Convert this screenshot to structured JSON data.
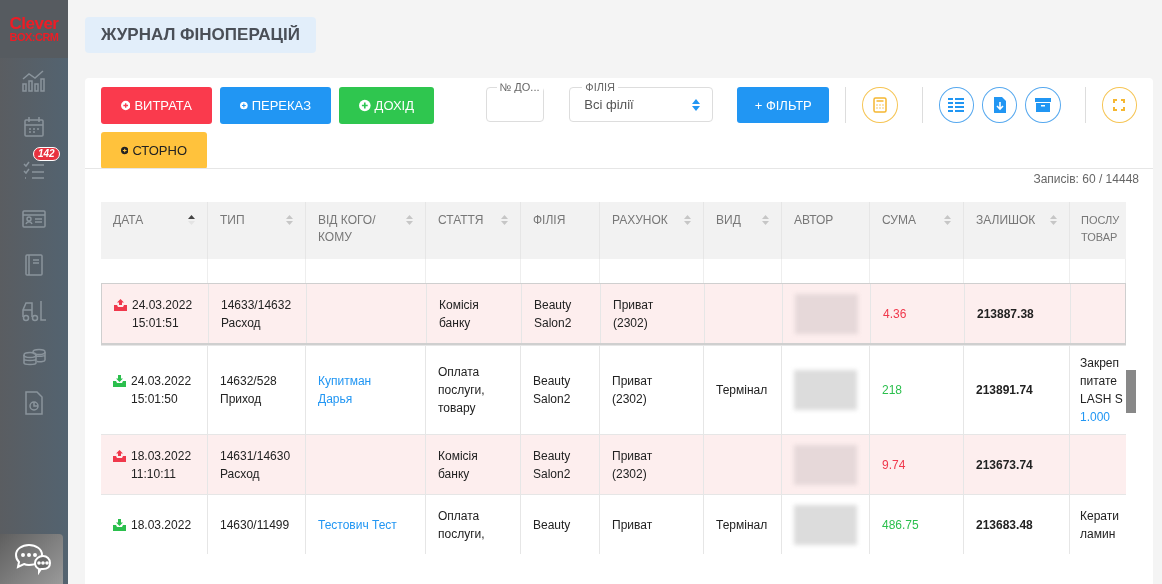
{
  "sidebar": {
    "logo_top": "Clever",
    "logo_bottom": "BOX:CRM",
    "tasks_badge": "142"
  },
  "page_title": "ЖУРНАЛ ФІНОПЕРАЦІЙ",
  "actions": [
    {
      "label": "ВИТРАТА",
      "kind": "danger"
    },
    {
      "label": "ПЕРЕКАЗ",
      "kind": "primary"
    },
    {
      "label": "ДОХІД",
      "kind": "success"
    },
    {
      "label": "СТОРНО",
      "kind": "warning"
    }
  ],
  "doc_field": {
    "label": "№ ДО..."
  },
  "branch_select": {
    "label": "ФІЛІЯ",
    "value": "Всі філії"
  },
  "filter_button": "+ ФІЛЬТР",
  "records": "Записів: 60 / 14448",
  "table": {
    "columns": [
      {
        "label": "ДАТА",
        "sortable": true,
        "sorted": true
      },
      {
        "label": "ТИП",
        "sortable": true,
        "sorted": false
      },
      {
        "label": "ВІД КОГО/КОМУ",
        "sortable": true,
        "sorted": false
      },
      {
        "label": "СТАТТЯ",
        "sortable": true,
        "sorted": false
      },
      {
        "label": "ФІЛІЯ",
        "sortable": false
      },
      {
        "label": "РАХУНОК",
        "sortable": true,
        "sorted": false
      },
      {
        "label": "ВИД",
        "sortable": true,
        "sorted": false
      },
      {
        "label": "АВТОР",
        "sortable": false
      },
      {
        "label": "СУМА",
        "sortable": true,
        "sorted": false
      },
      {
        "label": "ЗАЛИШОК",
        "sortable": true,
        "sorted": false
      },
      {
        "label": "ПОСЛУ ТОВАР",
        "sortable": false
      }
    ],
    "rows": [
      {
        "kind": "expense",
        "date": "24.03.2022",
        "time": "15:01:51",
        "number": "14633/14632",
        "type": "Расход",
        "article": [
          "Комісія",
          "банку"
        ],
        "branch": [
          "Beauty",
          "Salon2"
        ],
        "account": [
          "Приват",
          "(2302)"
        ],
        "sum": "4.36",
        "balance": "213887.38",
        "selected": true
      },
      {
        "kind": "income",
        "date": "24.03.2022",
        "time": "15:01:50",
        "number": "14632/528",
        "type": "Приход",
        "counterparty": [
          "Купитман",
          "Дарья"
        ],
        "article": [
          "Оплата",
          "послуги,",
          "товару"
        ],
        "branch": [
          "Beauty",
          "Salon2"
        ],
        "account": [
          "Приват",
          "(2302)"
        ],
        "method": "Термінал",
        "sum": "218",
        "balance": "213891.74",
        "services": [
          "Закреп",
          "питате",
          "LASH S"
        ],
        "quantity": "1.000",
        "selected": false
      },
      {
        "kind": "expense",
        "date": "18.03.2022",
        "time": "11:10:11",
        "number": "14631/14630",
        "type": "Расход",
        "article": [
          "Комісія",
          "банку"
        ],
        "branch": [
          "Beauty",
          "Salon2"
        ],
        "account": [
          "Приват",
          "(2302)"
        ],
        "sum": "9.74",
        "balance": "213673.74",
        "selected": false
      },
      {
        "kind": "income",
        "date": "18.03.2022",
        "number": "14630/11499",
        "counterparty": [
          "Тестович Тест"
        ],
        "article": [
          "Оплата",
          "послуги,"
        ],
        "branch": [
          "Beauty"
        ],
        "account": [
          "Приват"
        ],
        "method": "Термінал",
        "sum": "486.75",
        "balance": "213683.48",
        "services": [
          "Керати",
          "ламин"
        ],
        "selected": false
      }
    ]
  }
}
